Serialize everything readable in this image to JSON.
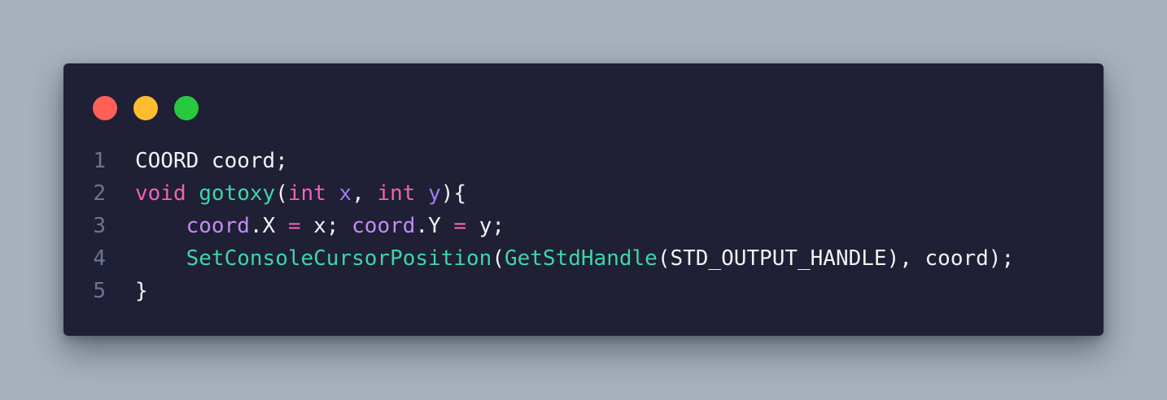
{
  "window": {
    "controls": [
      {
        "name": "close-dot",
        "color": "#ff5f57"
      },
      {
        "name": "minimize-dot",
        "color": "#febc2e"
      },
      {
        "name": "maximize-dot",
        "color": "#28c840"
      }
    ]
  },
  "colors": {
    "background": "#a6b1bd",
    "card": "#1f1f35",
    "plain": "#f2f2f2",
    "keyword": "#f062b8",
    "function": "#3dd5a8",
    "parameter": "#9d7cf0",
    "member": "#c18cf0",
    "line_number": "#6b7496"
  },
  "code": {
    "language": "c",
    "lines": [
      {
        "number": "1",
        "tokens": [
          {
            "type": "plain",
            "text": "COORD coord;"
          }
        ]
      },
      {
        "number": "2",
        "tokens": [
          {
            "type": "keyword",
            "text": "void"
          },
          {
            "type": "plain",
            "text": " "
          },
          {
            "type": "func",
            "text": "gotoxy"
          },
          {
            "type": "plain",
            "text": "("
          },
          {
            "type": "keyword",
            "text": "int"
          },
          {
            "type": "plain",
            "text": " "
          },
          {
            "type": "param",
            "text": "x"
          },
          {
            "type": "plain",
            "text": ", "
          },
          {
            "type": "keyword",
            "text": "int"
          },
          {
            "type": "plain",
            "text": " "
          },
          {
            "type": "param",
            "text": "y"
          },
          {
            "type": "plain",
            "text": "){"
          }
        ]
      },
      {
        "number": "3",
        "tokens": [
          {
            "type": "plain",
            "text": "    "
          },
          {
            "type": "member",
            "text": "coord"
          },
          {
            "type": "plain",
            "text": ".X "
          },
          {
            "type": "op",
            "text": "="
          },
          {
            "type": "plain",
            "text": " x; "
          },
          {
            "type": "member",
            "text": "coord"
          },
          {
            "type": "plain",
            "text": ".Y "
          },
          {
            "type": "op",
            "text": "="
          },
          {
            "type": "plain",
            "text": " y;"
          }
        ]
      },
      {
        "number": "4",
        "tokens": [
          {
            "type": "plain",
            "text": "    "
          },
          {
            "type": "func",
            "text": "SetConsoleCursorPosition"
          },
          {
            "type": "plain",
            "text": "("
          },
          {
            "type": "func",
            "text": "GetStdHandle"
          },
          {
            "type": "plain",
            "text": "(STD_OUTPUT_HANDLE), coord);"
          }
        ]
      },
      {
        "number": "5",
        "tokens": [
          {
            "type": "plain",
            "text": "}"
          }
        ]
      }
    ]
  }
}
